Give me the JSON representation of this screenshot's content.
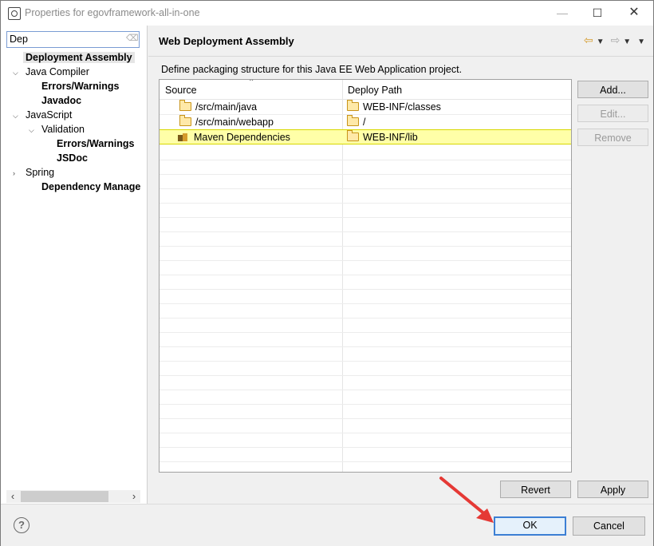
{
  "window": {
    "title": "Properties for egovframework-all-in-one",
    "controls": {
      "minimize": "—",
      "maximize": "☐",
      "close": "✕"
    }
  },
  "sidebar": {
    "filter_value": "Dep",
    "items": [
      {
        "label": "Deployment Assembly"
      },
      {
        "label": "Java Compiler"
      },
      {
        "label": "Errors/Warnings"
      },
      {
        "label": "Javadoc"
      },
      {
        "label": "JavaScript"
      },
      {
        "label": "Validation"
      },
      {
        "label": "Errors/Warnings"
      },
      {
        "label": "JSDoc"
      },
      {
        "label": "Spring"
      },
      {
        "label": "Dependency Manage"
      }
    ]
  },
  "main": {
    "title": "Web Deployment Assembly",
    "description": "Define packaging structure for this Java EE Web Application project.",
    "columns": {
      "source": "Source",
      "deploy_path": "Deploy Path"
    },
    "rows": [
      {
        "source": "/src/main/java",
        "deploy": "WEB-INF/classes"
      },
      {
        "source": "/src/main/webapp",
        "deploy": "/"
      },
      {
        "source": "Maven Dependencies",
        "deploy": "WEB-INF/lib"
      }
    ],
    "buttons": {
      "add": "Add...",
      "edit": "Edit...",
      "remove": "Remove",
      "revert": "Revert",
      "apply": "Apply"
    }
  },
  "footer": {
    "help": "?",
    "ok": "OK",
    "cancel": "Cancel"
  },
  "colors": {
    "accent": "#3c7fd4",
    "highlight_row": "#ffffa8",
    "arrow": "#e53935"
  }
}
